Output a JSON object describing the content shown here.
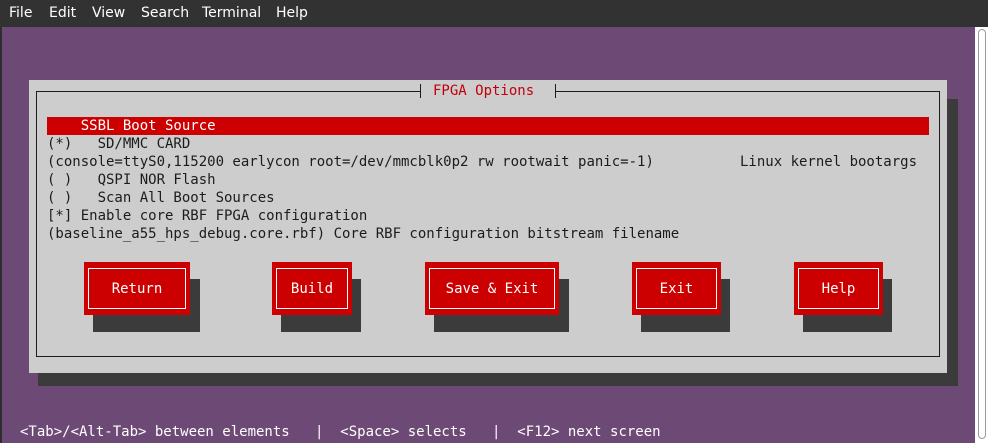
{
  "menubar": {
    "items": [
      "File",
      "Edit",
      "View",
      "Search",
      "Terminal",
      "Help"
    ]
  },
  "dialog": {
    "title": "FPGA Options",
    "items": [
      {
        "text": "    SSBL Boot Source",
        "selected": true
      },
      {
        "text": "(*)   SD/MMC CARD"
      },
      {
        "text": "(console=ttyS0,115200 earlycon root=/dev/mmcblk0p2 rw rootwait panic=-1)"
      },
      {
        "text": "( )   QSPI NOR Flash"
      },
      {
        "text": "( )   Scan All Boot Sources"
      },
      {
        "text": "[*] Enable core RBF FPGA configuration"
      },
      {
        "text": "(baseline_a55_hps_debug.core.rbf) Core RBF configuration bitstream filename"
      }
    ],
    "bootargs_label": "Linux kernel bootargs",
    "buttons": [
      "Return",
      "Build",
      "Save & Exit",
      "Exit",
      "Help"
    ]
  },
  "status_line": "<Tab>/<Alt-Tab> between elements   |  <Space> selects   |  <F12> next screen",
  "colors": {
    "terminal_bg": "#6d4a76",
    "dialog_bg": "#cdcdcd",
    "accent_red": "#cc0000",
    "title_red": "#c0000c"
  }
}
